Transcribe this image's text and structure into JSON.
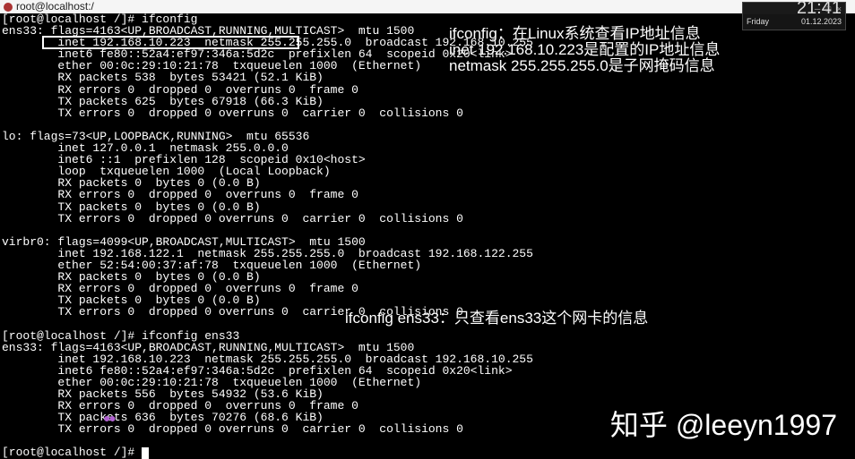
{
  "titlebar": {
    "text": "root@localhost:/"
  },
  "clock": {
    "time": "21:41",
    "day": "Friday",
    "date": "01.12.2023"
  },
  "terminal": {
    "lines": [
      "[root@localhost /]# ifconfig",
      "ens33: flags=4163<UP,BROADCAST,RUNNING,MULTICAST>  mtu 1500",
      "        inet 192.168.10.223  netmask 255.255.255.0  broadcast 192.168.10.255",
      "        inet6 fe80::52a4:ef97:346a:5d2c  prefixlen 64  scopeid 0x20<link>",
      "        ether 00:0c:29:10:21:78  txqueuelen 1000  (Ethernet)",
      "        RX packets 538  bytes 53421 (52.1 KiB)",
      "        RX errors 0  dropped 0  overruns 0  frame 0",
      "        TX packets 625  bytes 67918 (66.3 KiB)",
      "        TX errors 0  dropped 0 overruns 0  carrier 0  collisions 0",
      "",
      "lo: flags=73<UP,LOOPBACK,RUNNING>  mtu 65536",
      "        inet 127.0.0.1  netmask 255.0.0.0",
      "        inet6 ::1  prefixlen 128  scopeid 0x10<host>",
      "        loop  txqueuelen 1000  (Local Loopback)",
      "        RX packets 0  bytes 0 (0.0 B)",
      "        RX errors 0  dropped 0  overruns 0  frame 0",
      "        TX packets 0  bytes 0 (0.0 B)",
      "        TX errors 0  dropped 0 overruns 0  carrier 0  collisions 0",
      "",
      "virbr0: flags=4099<UP,BROADCAST,MULTICAST>  mtu 1500",
      "        inet 192.168.122.1  netmask 255.255.255.0  broadcast 192.168.122.255",
      "        ether 52:54:00:37:af:78  txqueuelen 1000  (Ethernet)",
      "        RX packets 0  bytes 0 (0.0 B)",
      "        RX errors 0  dropped 0  overruns 0  frame 0",
      "        TX packets 0  bytes 0 (0.0 B)",
      "        TX errors 0  dropped 0 overruns 0  carrier 0  collisions 0",
      "",
      "[root@localhost /]# ifconfig ens33",
      "ens33: flags=4163<UP,BROADCAST,RUNNING,MULTICAST>  mtu 1500",
      "        inet 192.168.10.223  netmask 255.255.255.0  broadcast 192.168.10.255",
      "        inet6 fe80::52a4:ef97:346a:5d2c  prefixlen 64  scopeid 0x20<link>",
      "        ether 00:0c:29:10:21:78  txqueuelen 1000  (Ethernet)",
      "        RX packets 556  bytes 54932 (53.6 KiB)",
      "        RX errors 0  dropped 0  overruns 0  frame 0",
      "        TX packets 636  bytes 70276 (68.6 KiB)",
      "        TX errors 0  dropped 0 overruns 0  carrier 0  collisions 0",
      "",
      "[root@localhost /]# "
    ]
  },
  "annotations": {
    "a1": "ifconfig：在Linux系统查看IP地址信息",
    "a2": "inet 192.168.10.223是配置的IP地址信息",
    "a3": "netmask 255.255.255.0是子网掩码信息",
    "a4": "ifconfig ens33：只查看ens33这个网卡的信息"
  },
  "watermark": "知乎 @leeyn1997"
}
